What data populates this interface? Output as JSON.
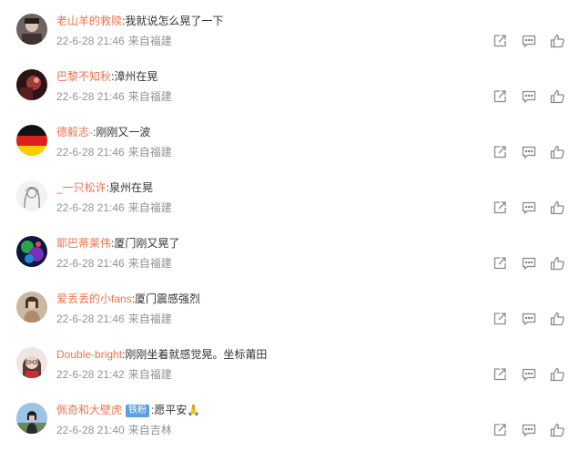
{
  "comments": [
    {
      "user": "老山羊的救赎",
      "text": ":我就说怎么晃了一下",
      "time": "22-6-28 21:46",
      "source": "来自福建",
      "badge": ""
    },
    {
      "user": "巴黎不知秋",
      "text": ":漳州在晃",
      "time": "22-6-28 21:46",
      "source": "来自福建",
      "badge": ""
    },
    {
      "user": "德毅志-",
      "text": ":刚刚又一波",
      "time": "22-6-28 21:46",
      "source": "来自福建",
      "badge": ""
    },
    {
      "user": "_一只松许",
      "text": ":泉州在晃",
      "time": "22-6-28 21:46",
      "source": "来自福建",
      "badge": ""
    },
    {
      "user": "耶巴蒂莱伟",
      "text": ":厦门刚又晃了",
      "time": "22-6-28 21:46",
      "source": "来自福建",
      "badge": ""
    },
    {
      "user": "爱丢丢的小fans",
      "text": ":厦门震感强烈",
      "time": "22-6-28 21:46",
      "source": "来自福建",
      "badge": ""
    },
    {
      "user": "Double-bright",
      "text": ":刚刚坐着就感觉晃。坐标莆田",
      "time": "22-6-28 21:42",
      "source": "来自福建",
      "badge": ""
    },
    {
      "user": "佩奇和大壁虎",
      "text": ":愿平安🙏",
      "time": "22-6-28 21:40",
      "source": "来自吉林",
      "badge": "铁粉"
    }
  ],
  "icons": {
    "share": "share-icon",
    "reply": "comment-icon",
    "like": "thumbs-up-icon"
  },
  "colors": {
    "username": "#eb7350",
    "meta": "#939393",
    "icon": "#8a8a8a",
    "badge": "#5ba0e6"
  }
}
